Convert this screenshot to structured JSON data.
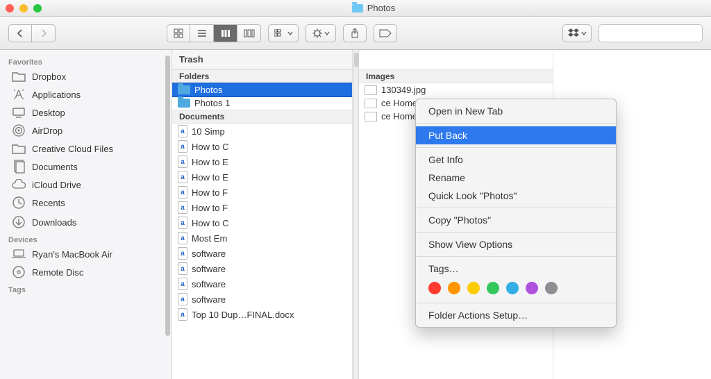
{
  "window": {
    "title": "Photos"
  },
  "sidebar": {
    "sections": [
      {
        "heading": "Favorites",
        "items": [
          {
            "icon": "folder",
            "label": "Dropbox"
          },
          {
            "icon": "apps",
            "label": "Applications"
          },
          {
            "icon": "desktop",
            "label": "Desktop"
          },
          {
            "icon": "airdrop",
            "label": "AirDrop"
          },
          {
            "icon": "folder",
            "label": "Creative Cloud Files"
          },
          {
            "icon": "documents",
            "label": "Documents"
          },
          {
            "icon": "icloud",
            "label": "iCloud Drive"
          },
          {
            "icon": "recents",
            "label": "Recents"
          },
          {
            "icon": "downloads",
            "label": "Downloads"
          }
        ]
      },
      {
        "heading": "Devices",
        "items": [
          {
            "icon": "laptop",
            "label": "Ryan's MacBook Air"
          },
          {
            "icon": "disc",
            "label": "Remote Disc"
          }
        ]
      },
      {
        "heading": "Tags",
        "items": []
      }
    ]
  },
  "trash": {
    "header": "Trash",
    "folders_label": "Folders",
    "folders": [
      {
        "label": "Photos",
        "selected": true
      },
      {
        "label": "Photos 1"
      }
    ],
    "documents_label": "Documents",
    "documents": [
      "10 Simp",
      "How to C",
      "How to E",
      "How to E",
      "How to F",
      "How to F",
      "How to C",
      "Most Em",
      "software",
      "software",
      "software",
      "software",
      "Top 10 Dup…FINAL.docx"
    ],
    "images_label": "Images",
    "images": [
      "130349.jpg",
      "ce Home.jpg",
      "ce Home.jpg"
    ]
  },
  "context_menu": {
    "items": [
      {
        "label": "Open in New Tab"
      },
      {
        "sep": true
      },
      {
        "label": "Put Back",
        "selected": true
      },
      {
        "sep": true
      },
      {
        "label": "Get Info"
      },
      {
        "label": "Rename"
      },
      {
        "label": "Quick Look \"Photos\""
      },
      {
        "sep": true
      },
      {
        "label": "Copy \"Photos\""
      },
      {
        "sep": true
      },
      {
        "label": "Show View Options"
      },
      {
        "sep": true
      },
      {
        "label": "Tags…"
      },
      {
        "tags": [
          "#ff3b30",
          "#ff9500",
          "#ffcc00",
          "#34c759",
          "#32ade6",
          "#af52de",
          "#8e8e93"
        ]
      },
      {
        "sep": true
      },
      {
        "label": "Folder Actions Setup…"
      }
    ]
  }
}
